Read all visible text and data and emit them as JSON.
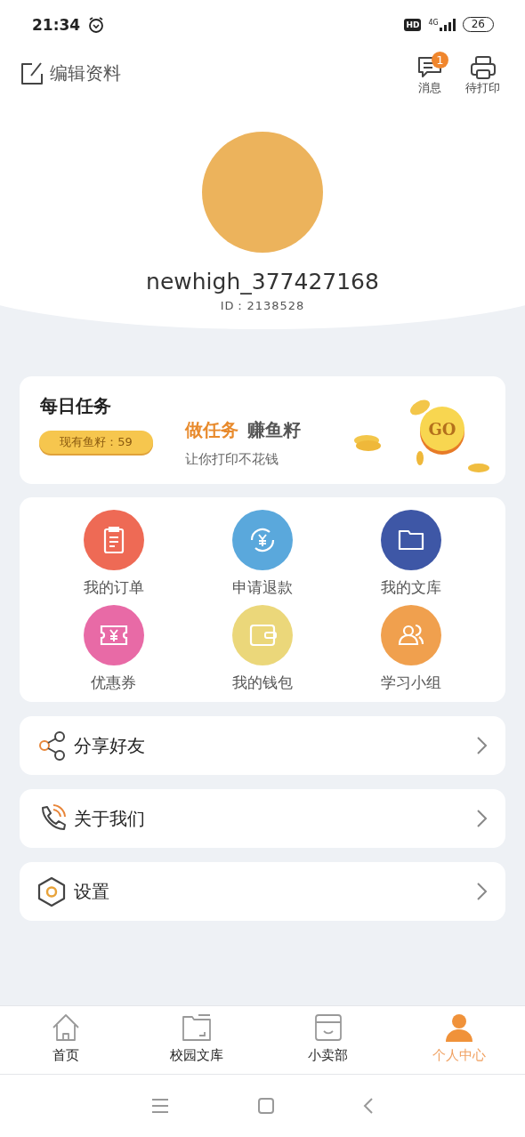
{
  "status_bar": {
    "time": "21:34",
    "hd": "HD",
    "network": "4G",
    "battery": "26"
  },
  "header": {
    "edit_label": "编辑资料",
    "actions": [
      {
        "label": "消息",
        "badge": "1"
      },
      {
        "label": "待打印"
      }
    ]
  },
  "profile": {
    "username": "newhigh_377427168",
    "id": "ID：2138528"
  },
  "daily_task": {
    "title": "每日任务",
    "balance": "现有鱼籽：59",
    "headline_accent": "做任务",
    "headline": "赚鱼籽",
    "subtitle": "让你打印不花钱",
    "go_label": "GO"
  },
  "shortcuts": [
    {
      "label": "我的订单",
      "color": "#ee6a55"
    },
    {
      "label": "申请退款",
      "color": "#5aa8dc"
    },
    {
      "label": "我的文库",
      "color": "#3e57a6"
    },
    {
      "label": "优惠券",
      "color": "#e86aa6"
    },
    {
      "label": "我的钱包",
      "color": "#ebd77a"
    },
    {
      "label": "学习小组",
      "color": "#f0a04e"
    }
  ],
  "menu": [
    {
      "label": "分享好友"
    },
    {
      "label": "关于我们"
    },
    {
      "label": "设置"
    }
  ],
  "tabs": [
    {
      "label": "首页",
      "selected": false
    },
    {
      "label": "校园文库",
      "selected": false
    },
    {
      "label": "小卖部",
      "selected": false
    },
    {
      "label": "个人中心",
      "selected": true
    }
  ]
}
